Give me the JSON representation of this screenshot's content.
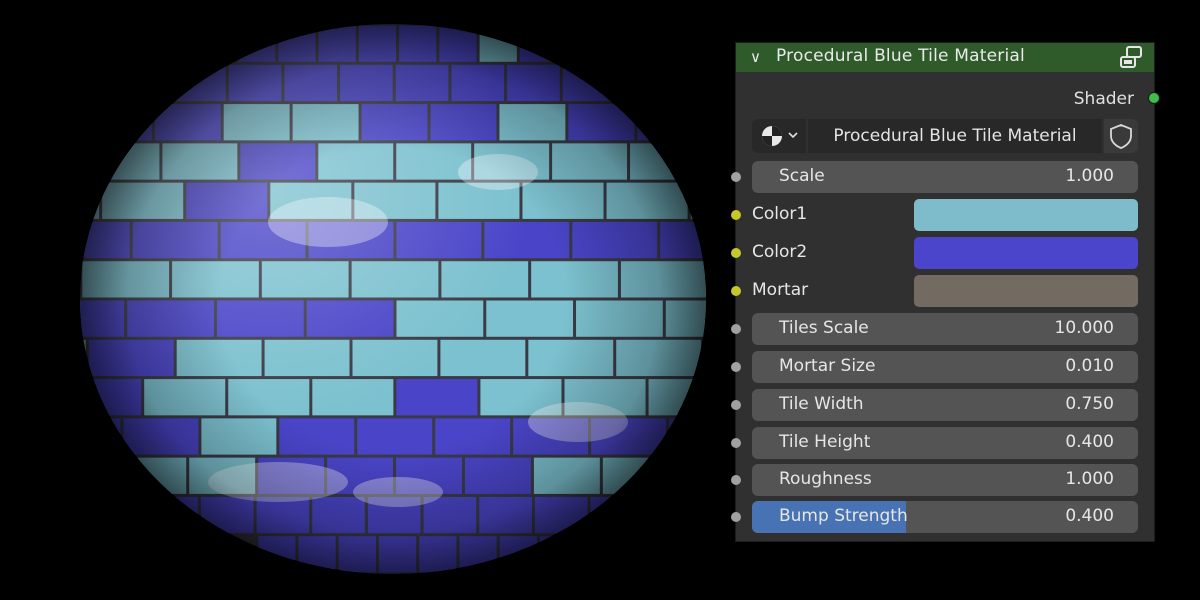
{
  "node": {
    "title": "Procedural Blue Tile Material",
    "header_color": "#2f5a2a",
    "output_label": "Shader",
    "output_socket_color": "#3cbf4a",
    "material_name": "Procedural Blue Tile Material",
    "icons": {
      "collapse": "chevron-down-icon",
      "header": "node-group-icon",
      "material_type": "material-sphere-icon",
      "fake_user": "shield-icon"
    }
  },
  "inputs": [
    {
      "label": "Scale",
      "value": "1.000",
      "kind": "float"
    },
    {
      "label": "Color1",
      "kind": "color",
      "color": "#7fbccb"
    },
    {
      "label": "Color2",
      "kind": "color",
      "color": "#4b45cc"
    },
    {
      "label": "Mortar",
      "kind": "color",
      "color": "#736a62"
    },
    {
      "label": "Tiles Scale",
      "value": "10.000",
      "kind": "float"
    },
    {
      "label": "Mortar Size",
      "value": "0.010",
      "kind": "float"
    },
    {
      "label": "Tile Width",
      "value": "0.750",
      "kind": "float"
    },
    {
      "label": "Tile Height",
      "value": "0.400",
      "kind": "float"
    },
    {
      "label": "Roughness",
      "value": "1.000",
      "kind": "float"
    },
    {
      "label": "Bump Strength",
      "value": "0.400",
      "kind": "float",
      "fill_fraction": 0.4
    }
  ],
  "preview": {
    "tile_light": "#7cc1cf",
    "tile_dark": "#4a45c8",
    "mortar": "#3a3a46",
    "background": "#000000"
  }
}
